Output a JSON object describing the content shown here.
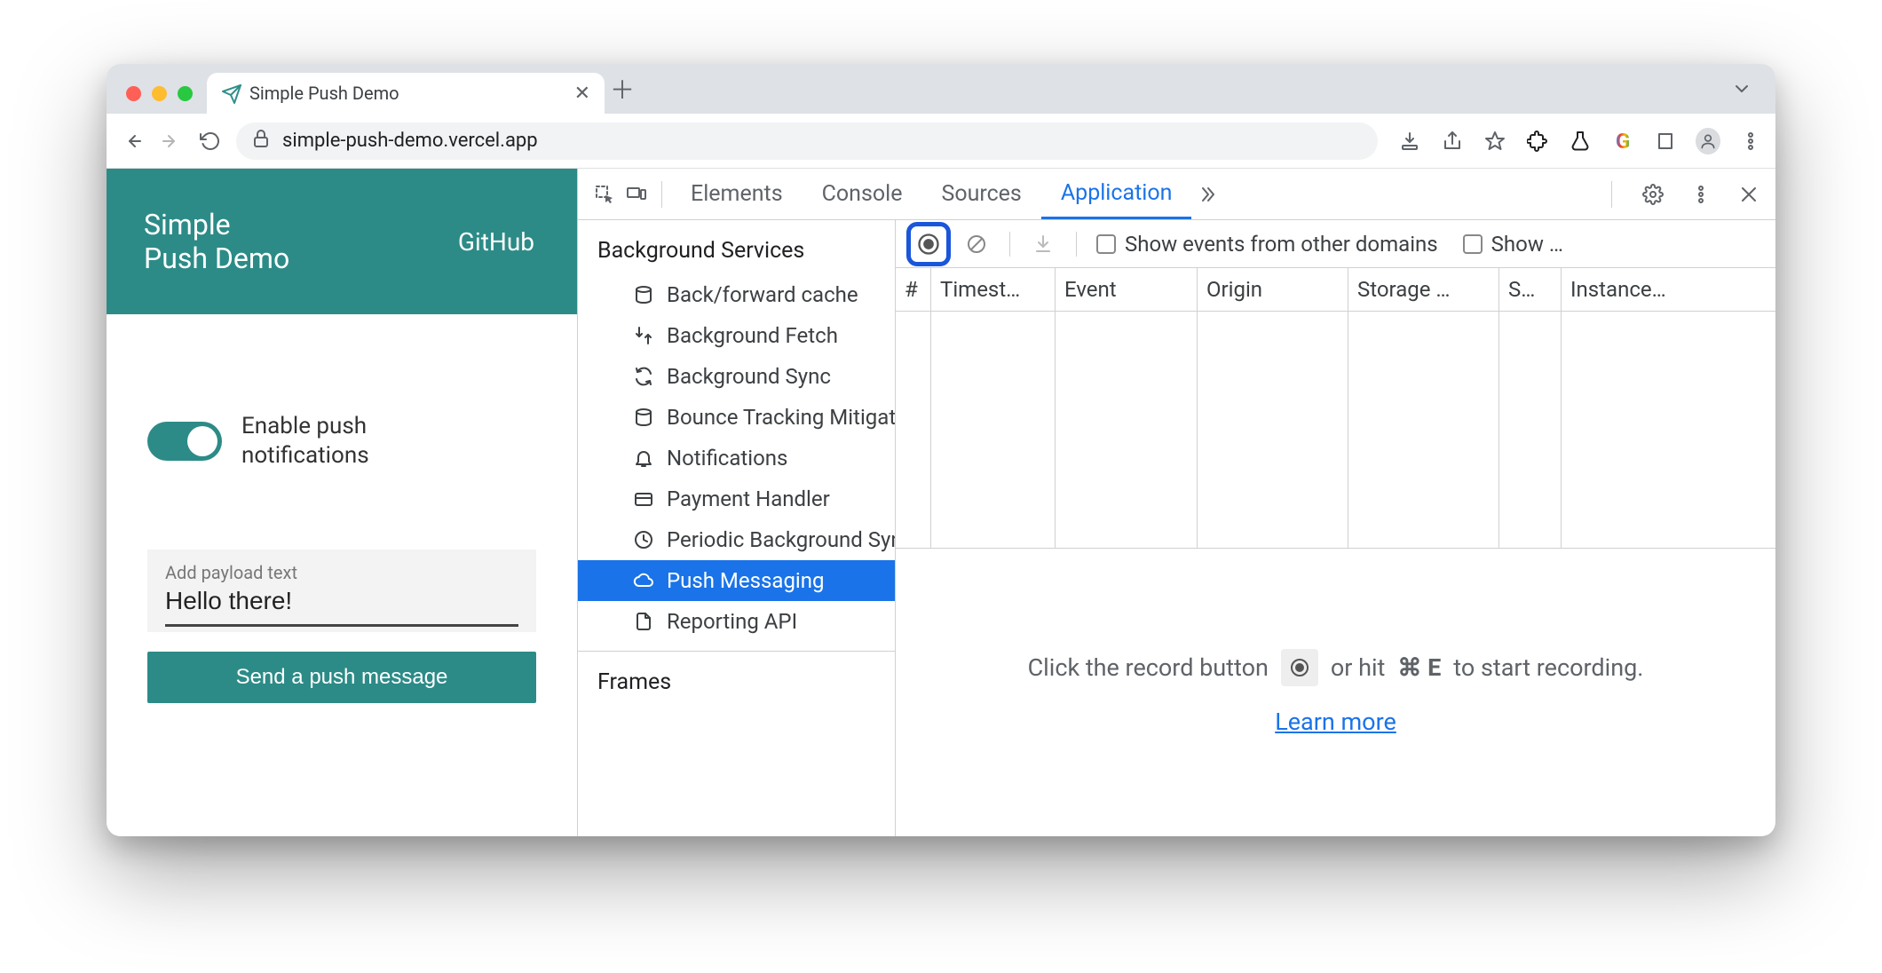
{
  "browser": {
    "tab_title": "Simple Push Demo",
    "url": "simple-push-demo.vercel.app"
  },
  "page": {
    "title_line1": "Simple",
    "title_line2": "Push Demo",
    "github_link": "GitHub",
    "toggle_label_line1": "Enable push",
    "toggle_label_line2": "notifications",
    "toggle_on": true,
    "payload_label": "Add payload text",
    "payload_value": "Hello there!",
    "send_button": "Send a push message"
  },
  "devtools": {
    "tabs": [
      "Elements",
      "Console",
      "Sources",
      "Application"
    ],
    "active_tab": "Application",
    "subtoolbar": {
      "show_other_domains_label": "Show events from other domains",
      "show_truncated_label": "Show …"
    },
    "sidebar": {
      "section1_title": "Background Services",
      "items": [
        "Back/forward cache",
        "Background Fetch",
        "Background Sync",
        "Bounce Tracking Mitigations",
        "Notifications",
        "Payment Handler",
        "Periodic Background Sync",
        "Push Messaging",
        "Reporting API"
      ],
      "selected_index": 7,
      "section2_title": "Frames"
    },
    "table_columns": [
      "#",
      "Timest…",
      "Event",
      "Origin",
      "Storage …",
      "S…",
      "Instance…"
    ],
    "empty_state": {
      "prefix": "Click the record button",
      "suffix_before_key": "or hit",
      "key_combo": "⌘ E",
      "suffix_after_key": "to start recording.",
      "learn_more": "Learn more"
    }
  },
  "colors": {
    "teal": "#2c8b87",
    "devtools_blue": "#1a73e8",
    "highlight_blue": "#1a56db"
  }
}
